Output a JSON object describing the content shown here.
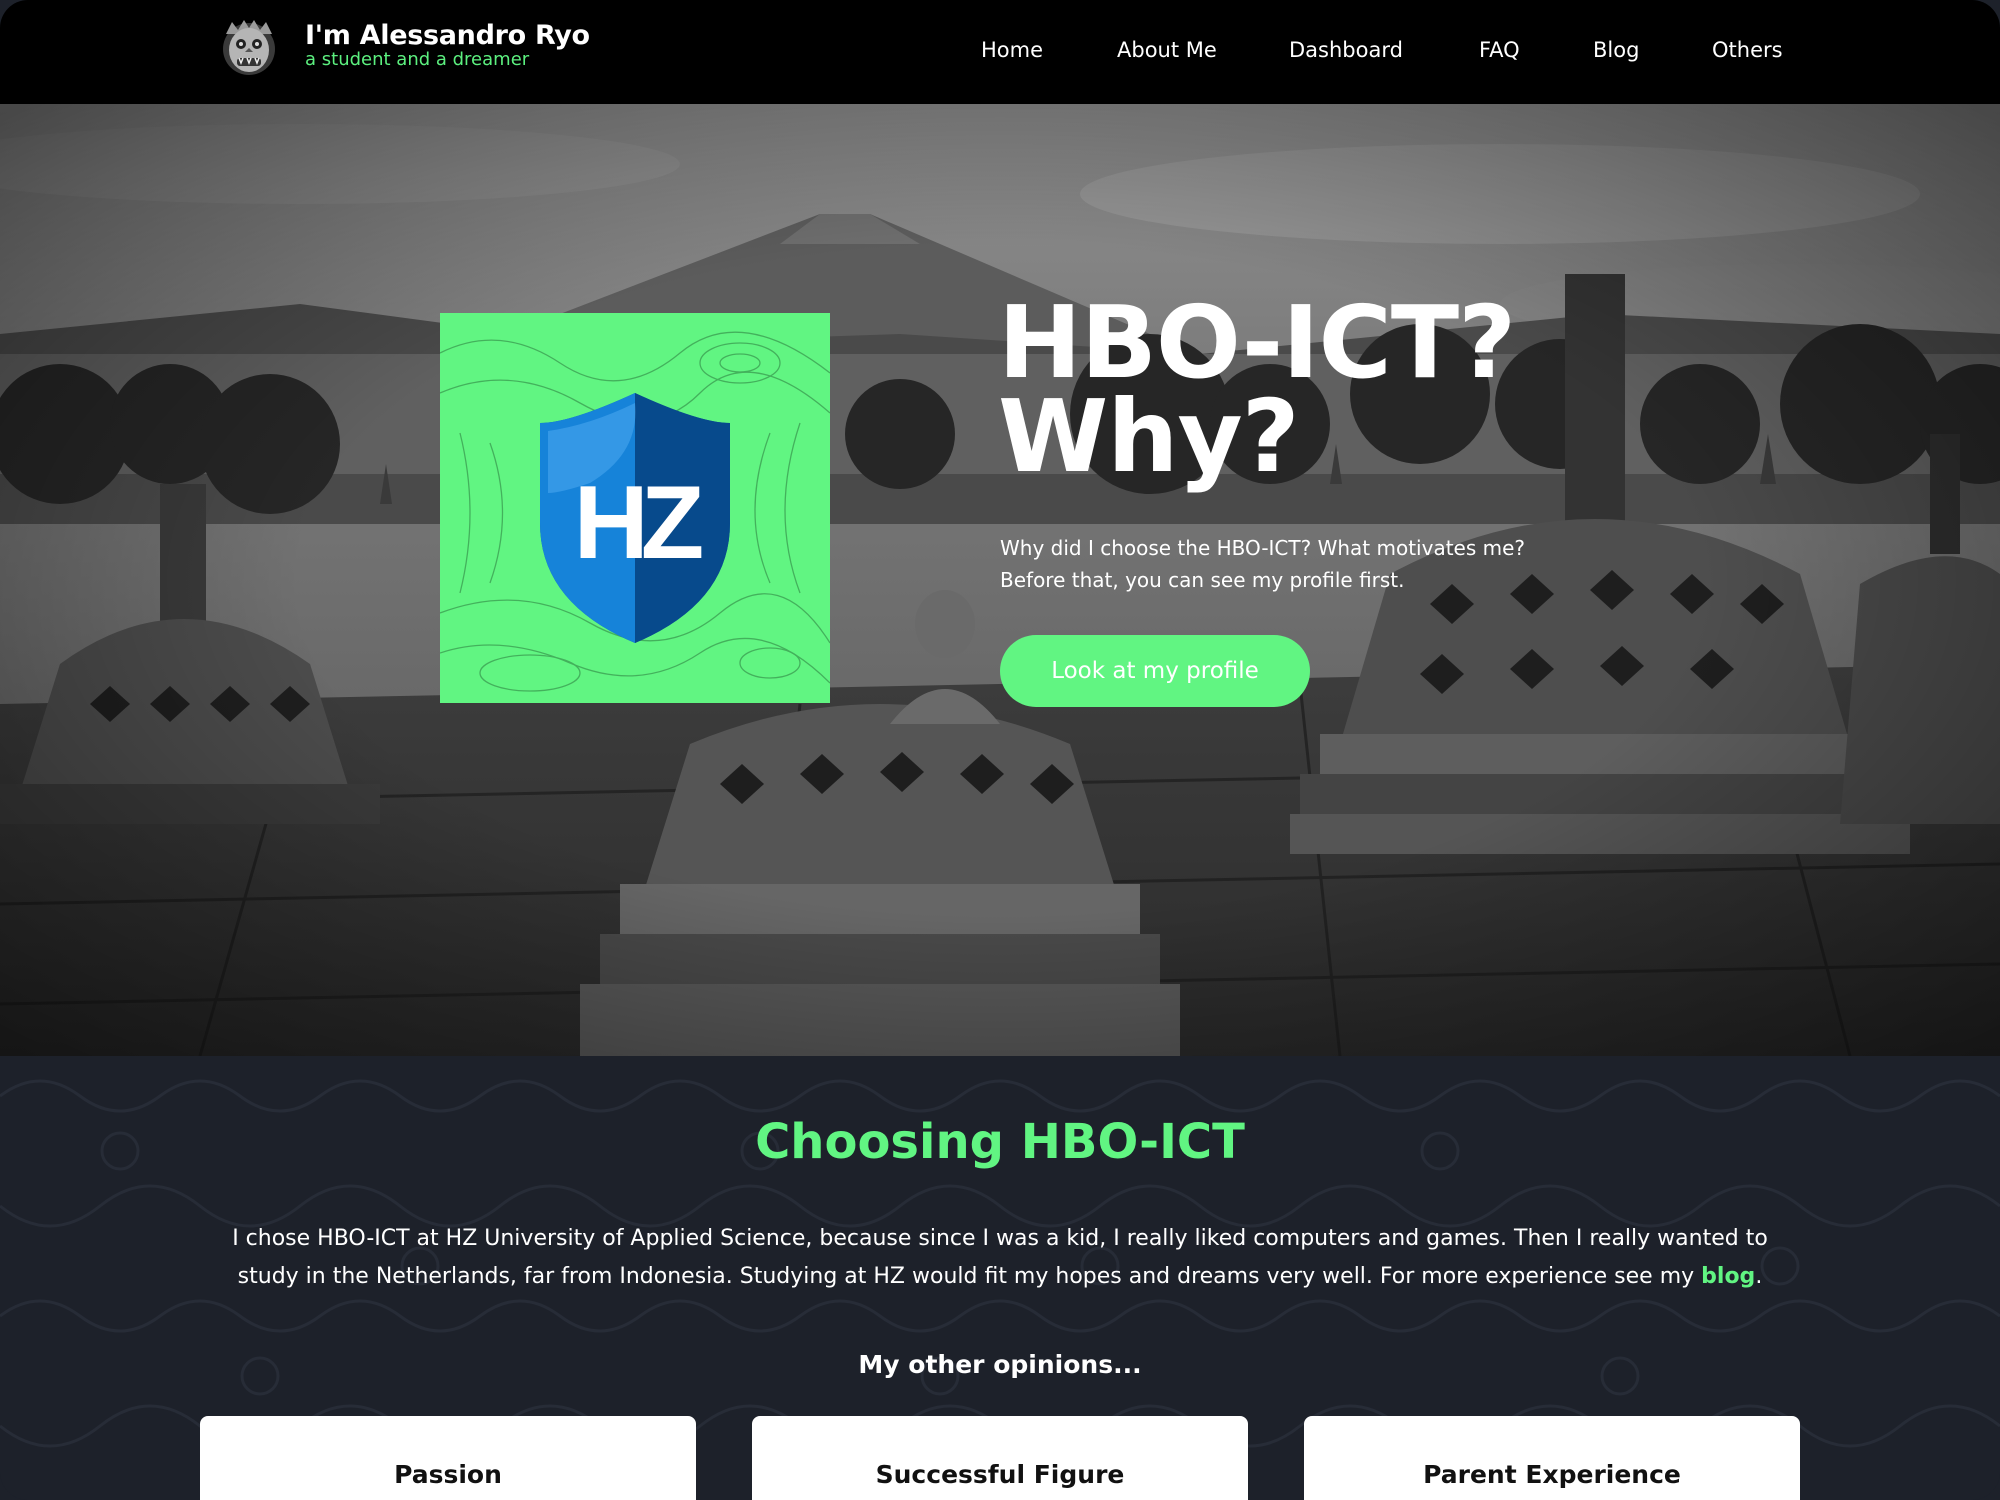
{
  "colors": {
    "accent": "#61f582",
    "navbar_bg": "#000000",
    "section_bg": "#1d212a",
    "hz_blue": "#0a5aa8"
  },
  "brand": {
    "name": "I'm Alessandro Ryo",
    "tagline": "a student and a dreamer",
    "logo_icon": "barong-mask-icon"
  },
  "nav": {
    "items": [
      {
        "label": "Home"
      },
      {
        "label": "About Me"
      },
      {
        "label": "Dashboard"
      },
      {
        "label": "FAQ"
      },
      {
        "label": "Blog"
      },
      {
        "label": "Others"
      }
    ]
  },
  "hero": {
    "title_line1": "HBO-ICT?",
    "title_line2": "Why?",
    "desc_line1": "Why did I choose the HBO-ICT? What motivates me?",
    "desc_line2": "Before that, you can see my profile first.",
    "cta_label": "Look at my profile",
    "logo_text": "HZ"
  },
  "section": {
    "title": "Choosing HBO-ICT",
    "text_before_link": "I chose HBO-ICT at HZ University of Applied Science, because since I was a kid, I really liked computers and games. Then I really wanted to study in the Netherlands, far from Indonesia. Studying at HZ would fit my hopes and dreams very well. For more experience see my ",
    "link_label": "blog",
    "text_after_link": ".",
    "subtitle": "My other opinions..."
  },
  "cards": [
    {
      "title": "Passion"
    },
    {
      "title": "Successful Figure"
    },
    {
      "title": "Parent Experience"
    }
  ]
}
